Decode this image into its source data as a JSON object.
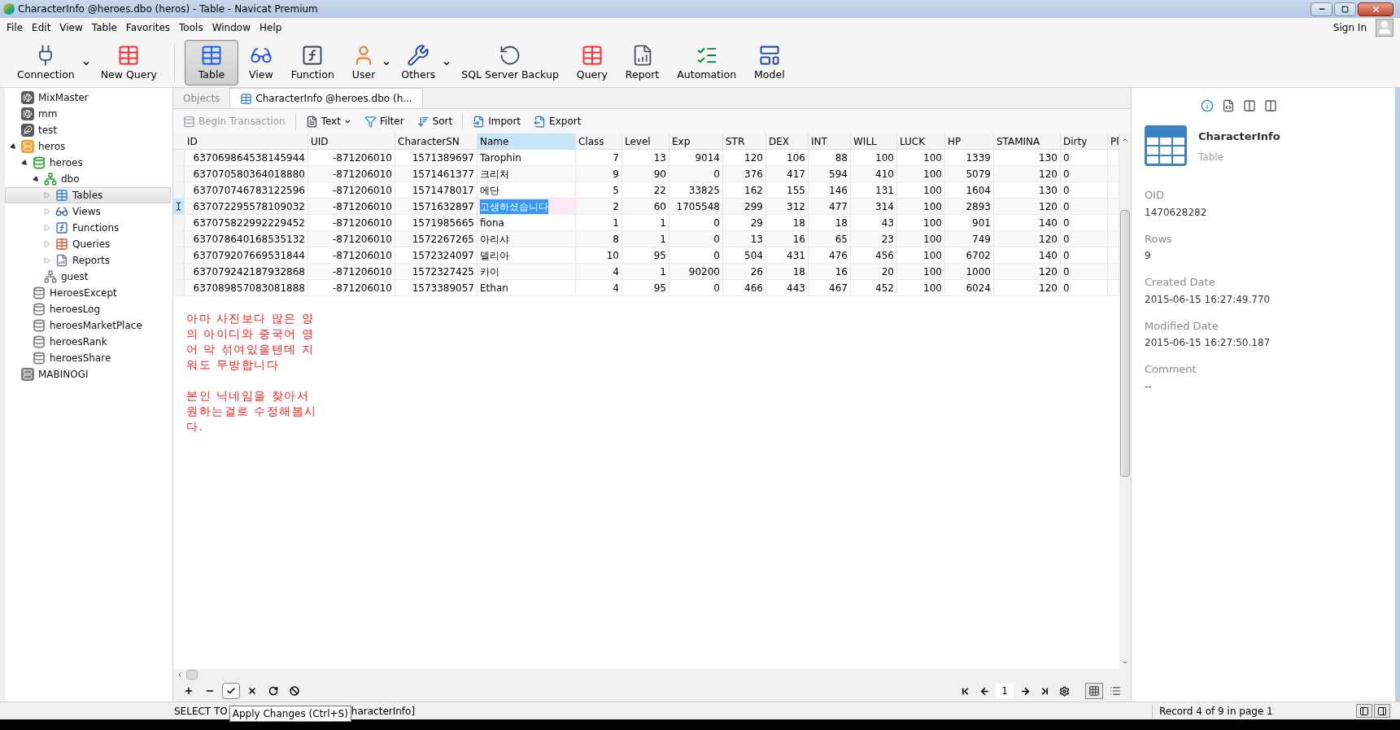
{
  "window": {
    "title": "CharacterInfo @heroes.dbo (heros) - Table - Navicat Premium"
  },
  "menu": [
    "File",
    "Edit",
    "View",
    "Table",
    "Favorites",
    "Tools",
    "Window",
    "Help"
  ],
  "sign_in": "Sign In",
  "toolbar": [
    {
      "kind": "connection",
      "label": "Connection",
      "dropdown": true,
      "selected": false
    },
    {
      "kind": "new_query",
      "label": "New Query",
      "dropdown": false,
      "selected": false
    },
    {
      "kind": "table",
      "label": "Table",
      "dropdown": false,
      "selected": true
    },
    {
      "kind": "view",
      "label": "View",
      "dropdown": false,
      "selected": false
    },
    {
      "kind": "function",
      "label": "Function",
      "dropdown": false,
      "selected": false
    },
    {
      "kind": "user",
      "label": "User",
      "dropdown": true,
      "selected": false
    },
    {
      "kind": "others",
      "label": "Others",
      "dropdown": true,
      "selected": false
    },
    {
      "kind": "backup",
      "label": "SQL Server Backup",
      "dropdown": false,
      "selected": false
    },
    {
      "kind": "query",
      "label": "Query",
      "dropdown": false,
      "selected": false
    },
    {
      "kind": "report",
      "label": "Report",
      "dropdown": false,
      "selected": false
    },
    {
      "kind": "automation",
      "label": "Automation",
      "dropdown": false,
      "selected": false
    },
    {
      "kind": "model",
      "label": "Model",
      "dropdown": false,
      "selected": false
    }
  ],
  "sidebar": {
    "items": [
      {
        "kind": "conn_dolphin",
        "label": "MixMaster",
        "selected": false
      },
      {
        "kind": "conn_dolphin",
        "label": "mm",
        "selected": false
      },
      {
        "kind": "conn_feather",
        "label": "test",
        "selected": false
      },
      {
        "kind": "conn_server",
        "label": "heros",
        "open": true,
        "expanded": true,
        "selected": false,
        "children": [
          {
            "kind": "database",
            "label": "heroes",
            "open": true,
            "expanded": true,
            "selected": false,
            "children": [
              {
                "kind": "schema",
                "label": "dbo",
                "open": true,
                "expanded": true,
                "selected": false,
                "children": [
                  {
                    "kind": "tables",
                    "label": "Tables",
                    "expanded": false,
                    "selected": true
                  },
                  {
                    "kind": "views",
                    "label": "Views",
                    "expanded": false,
                    "selected": false
                  },
                  {
                    "kind": "functions",
                    "label": "Functions",
                    "expanded": false,
                    "selected": false
                  },
                  {
                    "kind": "queries",
                    "label": "Queries",
                    "expanded": false,
                    "selected": false
                  },
                  {
                    "kind": "reports",
                    "label": "Reports",
                    "expanded": false,
                    "selected": false
                  }
                ]
              },
              {
                "kind": "schema",
                "label": "guest",
                "open": false,
                "selected": false
              }
            ]
          },
          {
            "kind": "database",
            "label": "HeroesExcept",
            "open": false,
            "selected": false
          },
          {
            "kind": "database",
            "label": "heroesLog",
            "open": false,
            "selected": false
          },
          {
            "kind": "database",
            "label": "heroesMarketPlace",
            "open": false,
            "selected": false
          },
          {
            "kind": "database",
            "label": "heroesRank",
            "open": false,
            "selected": false
          },
          {
            "kind": "database",
            "label": "heroesShare",
            "open": false,
            "selected": false
          }
        ]
      },
      {
        "kind": "conn_server",
        "label": "MABINOGI",
        "open": false,
        "selected": false
      }
    ]
  },
  "tabs": [
    {
      "label": "Objects",
      "selected": false,
      "icon": false
    },
    {
      "label": "CharacterInfo @heroes.dbo (h...",
      "selected": true,
      "icon": true
    }
  ],
  "table_toolbar": [
    {
      "kind": "transaction",
      "label": "Begin Transaction",
      "disabled": true,
      "dropdown": false
    },
    {
      "kind": "text",
      "label": "Text",
      "disabled": false,
      "dropdown": true
    },
    {
      "kind": "filter",
      "label": "Filter",
      "disabled": false,
      "dropdown": false
    },
    {
      "kind": "sort",
      "label": "Sort",
      "disabled": false,
      "dropdown": false
    },
    {
      "kind": "import",
      "label": "Import",
      "disabled": false,
      "dropdown": false
    },
    {
      "kind": "export",
      "label": "Export",
      "disabled": false,
      "dropdown": false
    }
  ],
  "table": {
    "columns": [
      {
        "label": "ID",
        "kind": "number",
        "selected": false
      },
      {
        "label": "UID",
        "kind": "number",
        "selected": false
      },
      {
        "label": "CharacterSN",
        "kind": "number",
        "selected": false
      },
      {
        "label": "Name",
        "kind": "text",
        "selected": true
      },
      {
        "label": "Class",
        "kind": "number",
        "selected": false
      },
      {
        "label": "Level",
        "kind": "number",
        "selected": false
      },
      {
        "label": "Exp",
        "kind": "number",
        "selected": false
      },
      {
        "label": "STR",
        "kind": "number",
        "selected": false
      },
      {
        "label": "DEX",
        "kind": "number",
        "selected": false
      },
      {
        "label": "INT",
        "kind": "number",
        "selected": false
      },
      {
        "label": "WILL",
        "kind": "number",
        "selected": false
      },
      {
        "label": "LUCK",
        "kind": "number",
        "selected": false
      },
      {
        "label": "HP",
        "kind": "number",
        "selected": false
      },
      {
        "label": "STAMINA",
        "kind": "number",
        "selected": false
      },
      {
        "label": "Dirty",
        "kind": "text",
        "selected": false
      },
      {
        "label": "Pl",
        "kind": "text",
        "selected": false
      }
    ],
    "rows": [
      {
        "selected": false,
        "cells": [
          "637069864538145944",
          "-871206010",
          "1571389697",
          "Tarophin",
          "7",
          "13",
          "9014",
          "120",
          "106",
          "88",
          "100",
          "100",
          "1339",
          "130",
          "0"
        ]
      },
      {
        "selected": false,
        "cells": [
          "637070580364018880",
          "-871206010",
          "1571461377",
          "크리처",
          "9",
          "90",
          "0",
          "376",
          "417",
          "594",
          "410",
          "100",
          "5079",
          "120",
          "0"
        ]
      },
      {
        "selected": false,
        "cells": [
          "637070746783122596",
          "-871206010",
          "1571478017",
          "에단",
          "5",
          "22",
          "33825",
          "162",
          "155",
          "146",
          "131",
          "100",
          "1604",
          "130",
          "0"
        ]
      },
      {
        "selected": true,
        "cells": [
          "637072295578109032",
          "-871206010",
          "1571632897",
          "고생하셨습니다",
          "2",
          "60",
          "1705548",
          "299",
          "312",
          "477",
          "314",
          "100",
          "2893",
          "120",
          "0"
        ]
      },
      {
        "selected": false,
        "cells": [
          "637075822992229452",
          "-871206010",
          "1571985665",
          "fiona",
          "1",
          "1",
          "0",
          "29",
          "18",
          "18",
          "43",
          "100",
          "901",
          "140",
          "0"
        ]
      },
      {
        "selected": false,
        "cells": [
          "637078640168535132",
          "-871206010",
          "1572267265",
          "아리샤",
          "8",
          "1",
          "0",
          "13",
          "16",
          "65",
          "23",
          "100",
          "749",
          "120",
          "0"
        ]
      },
      {
        "selected": false,
        "cells": [
          "637079207669531844",
          "-871206010",
          "1572324097",
          "델리아",
          "10",
          "95",
          "0",
          "504",
          "431",
          "476",
          "456",
          "100",
          "6702",
          "140",
          "0"
        ]
      },
      {
        "selected": false,
        "cells": [
          "637079242187932868",
          "-871206010",
          "1572327425",
          "카이",
          "4",
          "1",
          "90200",
          "26",
          "18",
          "16",
          "20",
          "100",
          "1000",
          "120",
          "0"
        ]
      },
      {
        "selected": false,
        "cells": [
          "637089857083081888",
          "-871206010",
          "1573389057",
          "Ethan",
          "4",
          "95",
          "0",
          "466",
          "443",
          "467",
          "452",
          "100",
          "6024",
          "120",
          "0"
        ]
      }
    ]
  },
  "note": [
    "아마 사진보다 많은 양의 아이디와 중국어 영어 막 섞여있을텐데 지워도 무방합니다",
    "본인 닉네임을 찾아서 원하는걸로 수정해봅시다."
  ],
  "bottom_tools": [
    {
      "kind": "add",
      "pressed": false
    },
    {
      "kind": "remove",
      "pressed": false
    },
    {
      "kind": "apply",
      "pressed": true
    },
    {
      "kind": "discard",
      "pressed": false
    },
    {
      "kind": "refresh",
      "pressed": false
    },
    {
      "kind": "stop",
      "pressed": false
    }
  ],
  "page_number": "1",
  "views": [
    {
      "kind": "grid",
      "selected": true
    },
    {
      "kind": "form",
      "selected": false
    }
  ],
  "tooltip": "Apply Changes (Ctrl+S)",
  "status_bar": {
    "query_start": "SELECT TO",
    "query_end": "haracterInfo]",
    "record": "Record 4 of 9 in page 1"
  },
  "info": {
    "name": "CharacterInfo",
    "type": "Table",
    "tabs": [
      {
        "kind": "info",
        "selected": true
      },
      {
        "kind": "ddl",
        "selected": false
      },
      {
        "kind": "deps",
        "selected": false
      },
      {
        "kind": "refs",
        "selected": false
      }
    ],
    "fields": [
      {
        "label": "OID",
        "value": "1470628282"
      },
      {
        "label": "Rows",
        "value": "9"
      },
      {
        "label": "Created Date",
        "value": "2015-06-15 16:27:49.770"
      },
      {
        "label": "Modified Date",
        "value": "2015-06-15 16:27:50.187"
      },
      {
        "label": "Comment",
        "value": "--"
      }
    ]
  }
}
